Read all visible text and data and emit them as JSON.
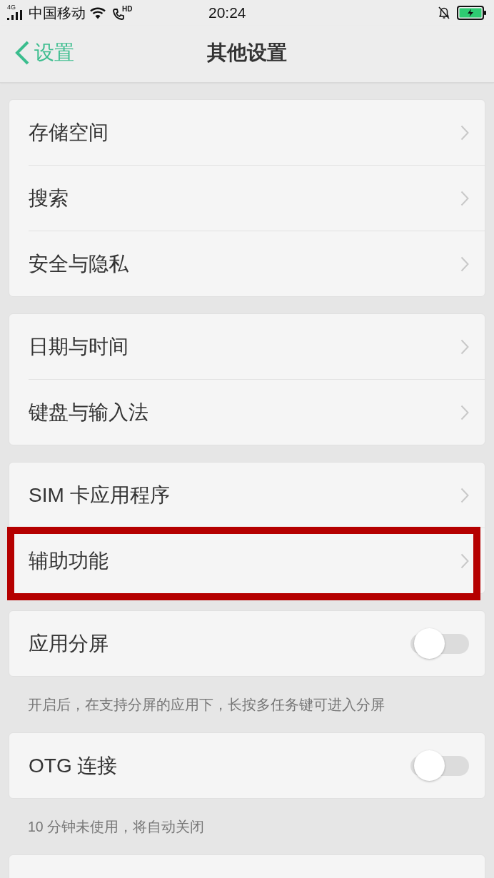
{
  "status_bar": {
    "network_type": "4G",
    "carrier": "中国移动",
    "call_badge": "HD",
    "time": "20:24"
  },
  "nav": {
    "back_label": "设置",
    "title": "其他设置"
  },
  "groups": [
    {
      "items": [
        {
          "kind": "link",
          "label": "存储空间",
          "highlighted": false
        },
        {
          "kind": "link",
          "label": "搜索",
          "highlighted": false
        },
        {
          "kind": "link",
          "label": "安全与隐私",
          "highlighted": false
        }
      ]
    },
    {
      "items": [
        {
          "kind": "link",
          "label": "日期与时间",
          "highlighted": false
        },
        {
          "kind": "link",
          "label": "键盘与输入法",
          "highlighted": false
        }
      ]
    },
    {
      "items": [
        {
          "kind": "link",
          "label": "SIM 卡应用程序",
          "highlighted": false
        },
        {
          "kind": "link",
          "label": "辅助功能",
          "highlighted": true
        }
      ]
    },
    {
      "items": [
        {
          "kind": "toggle",
          "label": "应用分屏",
          "on": false,
          "highlighted": false
        }
      ],
      "note": "开启后，在支持分屏的应用下，长按多任务键可进入分屏"
    },
    {
      "items": [
        {
          "kind": "toggle",
          "label": "OTG 连接",
          "on": false,
          "highlighted": false
        }
      ],
      "note": "10 分钟未使用，将自动关闭"
    }
  ]
}
